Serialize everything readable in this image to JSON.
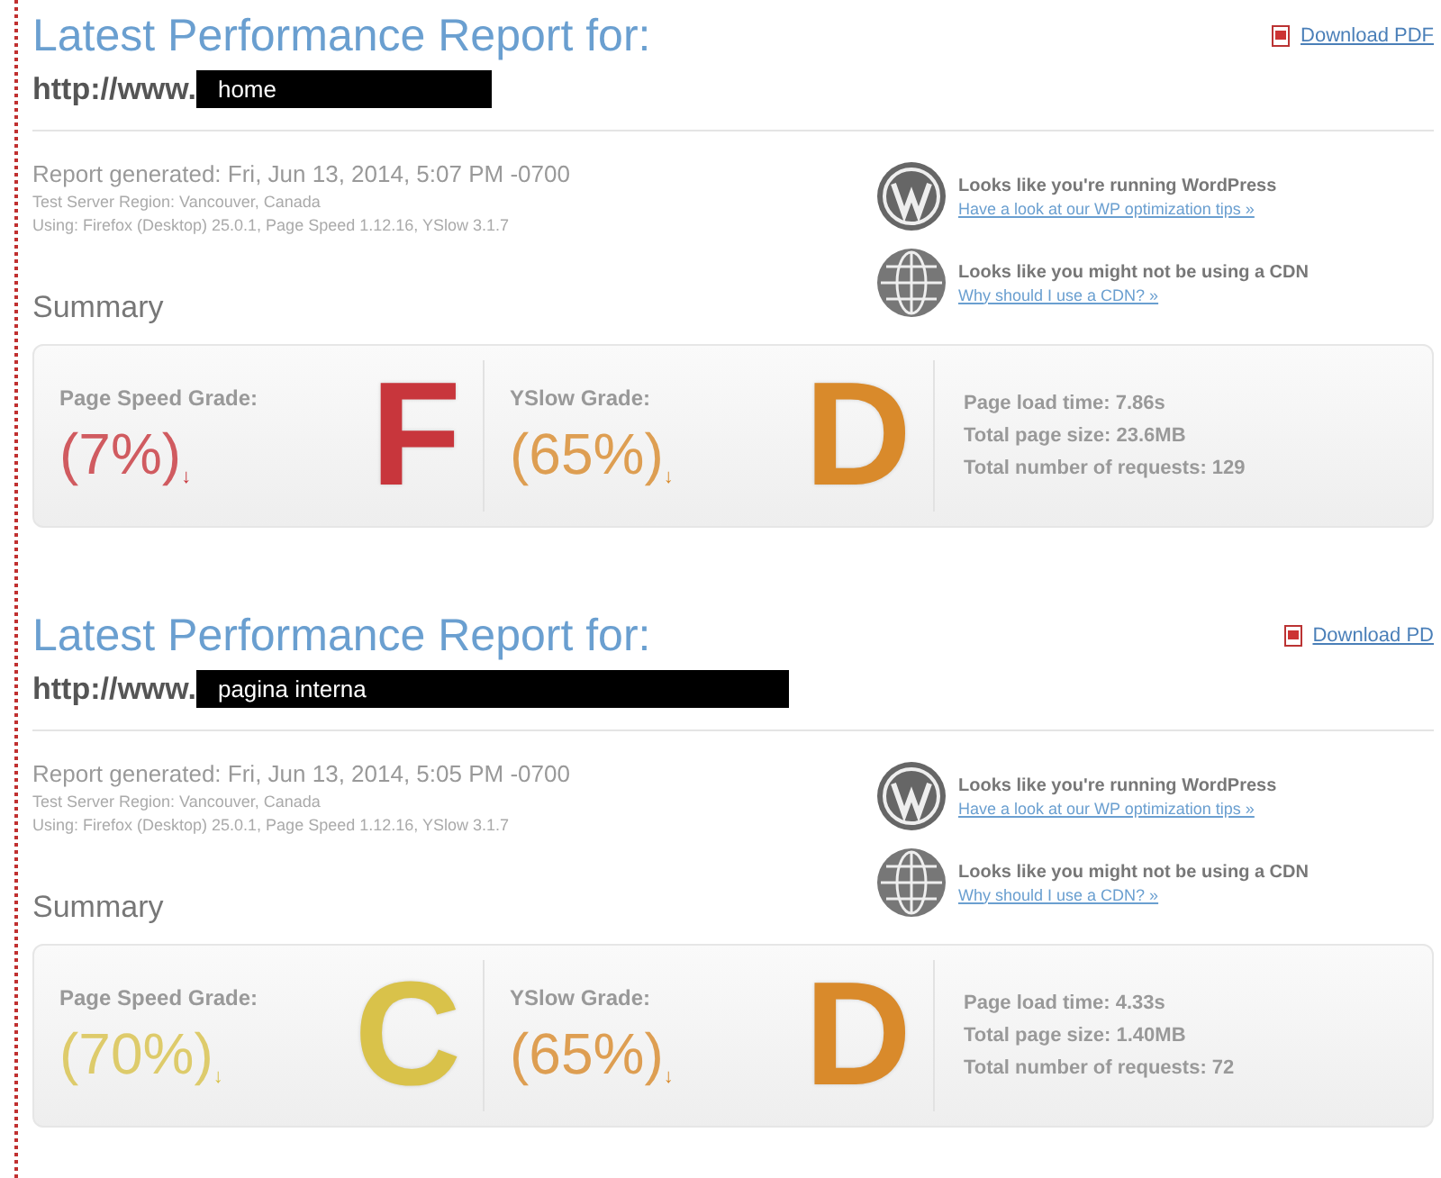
{
  "reports": [
    {
      "title": "Latest Performance Report for:",
      "url_prefix": "http://www.",
      "url_redacted": "home",
      "download": "Download PDF",
      "generated": "Report generated: Fri, Jun 13, 2014, 5:07 PM -0700",
      "region": "Test Server Region: Vancouver, Canada",
      "using": "Using: Firefox (Desktop) 25.0.1, Page Speed 1.12.16, YSlow 3.1.7",
      "notices": [
        {
          "kind": "wordpress",
          "text": "Looks like you're running WordPress",
          "link": "Have a look at our WP optimization tips »"
        },
        {
          "kind": "globe",
          "text": "Looks like you might not be using a CDN",
          "link": "Why should I use a CDN? »"
        }
      ],
      "summary": "Summary",
      "grades": [
        {
          "label": "Page Speed Grade:",
          "value": "(7%)",
          "arrow": "↓",
          "letter": "F",
          "color": "#c8363c"
        },
        {
          "label": "YSlow Grade:",
          "value": "(65%)",
          "arrow": "↓",
          "letter": "D",
          "color": "#d98a2b"
        }
      ],
      "stats": [
        "Page load time: 7.86s",
        "Total page size: 23.6MB",
        "Total number of requests: 129"
      ]
    },
    {
      "title": "Latest Performance Report for:",
      "url_prefix": "http://www.",
      "url_redacted": "pagina interna",
      "download": "Download PD",
      "generated": "Report generated: Fri, Jun 13, 2014, 5:05 PM -0700",
      "region": "Test Server Region: Vancouver, Canada",
      "using": "Using: Firefox (Desktop) 25.0.1, Page Speed 1.12.16, YSlow 3.1.7",
      "notices": [
        {
          "kind": "wordpress",
          "text": "Looks like you're running WordPress",
          "link": "Have a look at our WP optimization tips »"
        },
        {
          "kind": "globe",
          "text": "Looks like you might not be using a CDN",
          "link": "Why should I use a CDN? »"
        }
      ],
      "summary": "Summary",
      "grades": [
        {
          "label": "Page Speed Grade:",
          "value": "(70%)",
          "arrow": "↓",
          "letter": "C",
          "color": "#d9c24a"
        },
        {
          "label": "YSlow Grade:",
          "value": "(65%)",
          "arrow": "↓",
          "letter": "D",
          "color": "#d98a2b"
        }
      ],
      "stats": [
        "Page load time: 4.33s",
        "Total page size: 1.40MB",
        "Total number of requests: 72"
      ]
    }
  ]
}
